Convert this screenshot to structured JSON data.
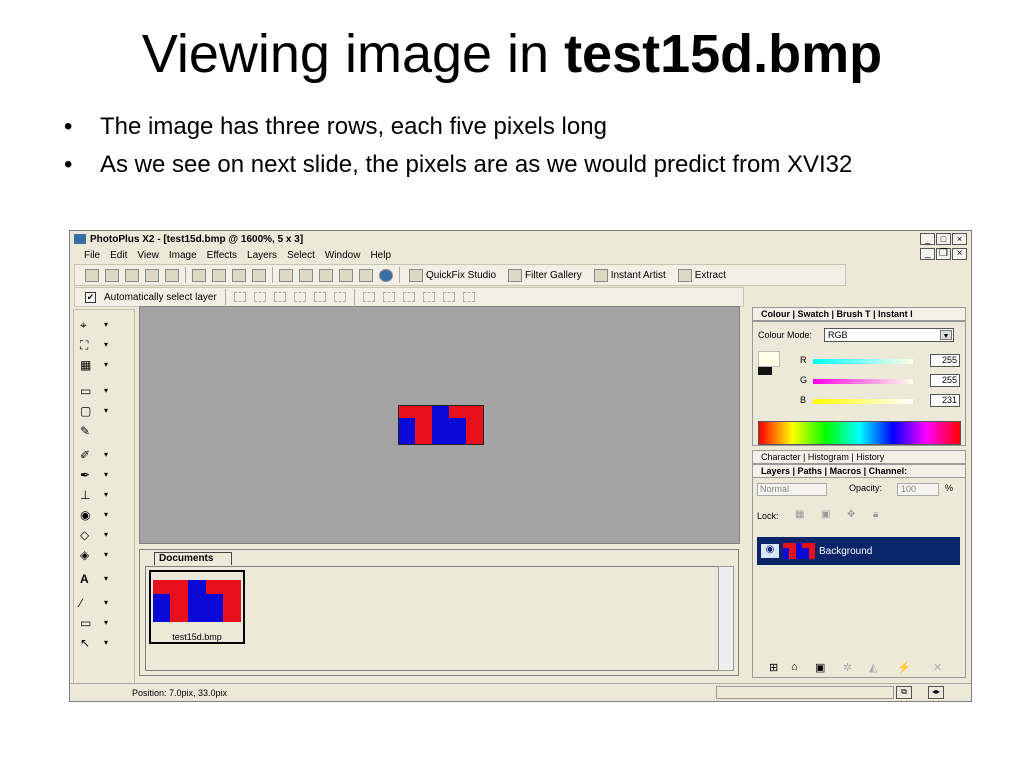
{
  "slide": {
    "title_plain": "Viewing image in ",
    "title_bold": "test15d.bmp",
    "bullets": [
      "The image has three rows, each five pixels long",
      "As we see on next slide, the pixels are as we would predict from XVI32"
    ]
  },
  "app": {
    "window_title": "PhotoPlus X2 - [test15d.bmp @ 1600%, 5 x 3]",
    "menu": [
      "File",
      "Edit",
      "View",
      "Image",
      "Effects",
      "Layers",
      "Select",
      "Window",
      "Help"
    ],
    "toolbar": {
      "quickfix": "QuickFix Studio",
      "filter_gallery": "Filter Gallery",
      "instant_artist": "Instant Artist",
      "extract": "Extract"
    },
    "context": {
      "auto_select": "Automatically select layer"
    },
    "documents": {
      "tab": "Documents",
      "thumb_label": "test15d.bmp"
    },
    "colour": {
      "tabs": "Colour | Swatch | Brush T | Instant I",
      "mode_label": "Colour Mode:",
      "mode_value": "RGB",
      "r_label": "R",
      "r_value": "255",
      "g_label": "G",
      "g_value": "255",
      "b_label": "B",
      "b_value": "231"
    },
    "panels": {
      "char_tabs": "Character | Histogram | History",
      "layers_tabs": "Layers | Paths | Macros | Channel:",
      "blend_mode": "Normal",
      "opacity_label": "Opacity:",
      "opacity_value": "100",
      "opacity_unit": "%",
      "lock_label": "Lock:",
      "layer_name": "Background"
    },
    "status": {
      "position": "Position: 7.0pix, 33.0pix"
    },
    "colors": {
      "red": "#e8101a",
      "blue": "#0a0ad8",
      "selection": "#0a246a"
    }
  }
}
